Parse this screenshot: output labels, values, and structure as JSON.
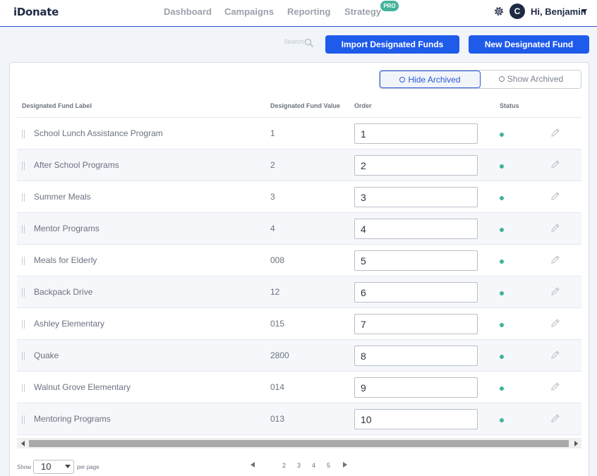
{
  "app": {
    "logo": "iDonate"
  },
  "nav": {
    "items": [
      {
        "label": "Dashboard"
      },
      {
        "label": "Campaigns"
      },
      {
        "label": "Reporting"
      },
      {
        "label": "Strategy"
      }
    ],
    "pro_badge": "PRO"
  },
  "user": {
    "avatar_initial": "C",
    "greeting": "Hi, Benjamin"
  },
  "toolbar": {
    "search_placeholder": "Search",
    "import_label": "Import Designated Funds",
    "new_label": "New Designated Fund",
    "primary_color": "#1f5bea"
  },
  "filter": {
    "hide_archived": "Hide Archived",
    "show_archived": "Show Archived",
    "selected": "Hide Archived"
  },
  "table": {
    "columns": [
      "Designated Fund Label",
      "Designated Fund Value",
      "Order",
      "Status"
    ],
    "rows": [
      {
        "label": "School Lunch Assistance Program",
        "value": "1",
        "order": "1",
        "status": "active"
      },
      {
        "label": "After School Programs",
        "value": "2",
        "order": "2",
        "status": "active"
      },
      {
        "label": "Summer Meals",
        "value": "3",
        "order": "3",
        "status": "active"
      },
      {
        "label": "Mentor Programs",
        "value": "4",
        "order": "4",
        "status": "active"
      },
      {
        "label": "Meals for Elderly",
        "value": "008",
        "order": "5",
        "status": "active"
      },
      {
        "label": "Backpack Drive",
        "value": "12",
        "order": "6",
        "status": "active"
      },
      {
        "label": "Ashley Elementary",
        "value": "015",
        "order": "7",
        "status": "active"
      },
      {
        "label": "Quake",
        "value": "2800",
        "order": "8",
        "status": "active"
      },
      {
        "label": "Walnut Grove Elementary",
        "value": "014",
        "order": "9",
        "status": "active"
      },
      {
        "label": "Mentoring Programs",
        "value": "013",
        "order": "10",
        "status": "active"
      }
    ],
    "status_color": "#3fb39c"
  },
  "footer": {
    "show_label": "Show",
    "per_page_value": "10",
    "per_page_label": "per page",
    "pages": [
      "2",
      "3",
      "4",
      "5"
    ]
  }
}
